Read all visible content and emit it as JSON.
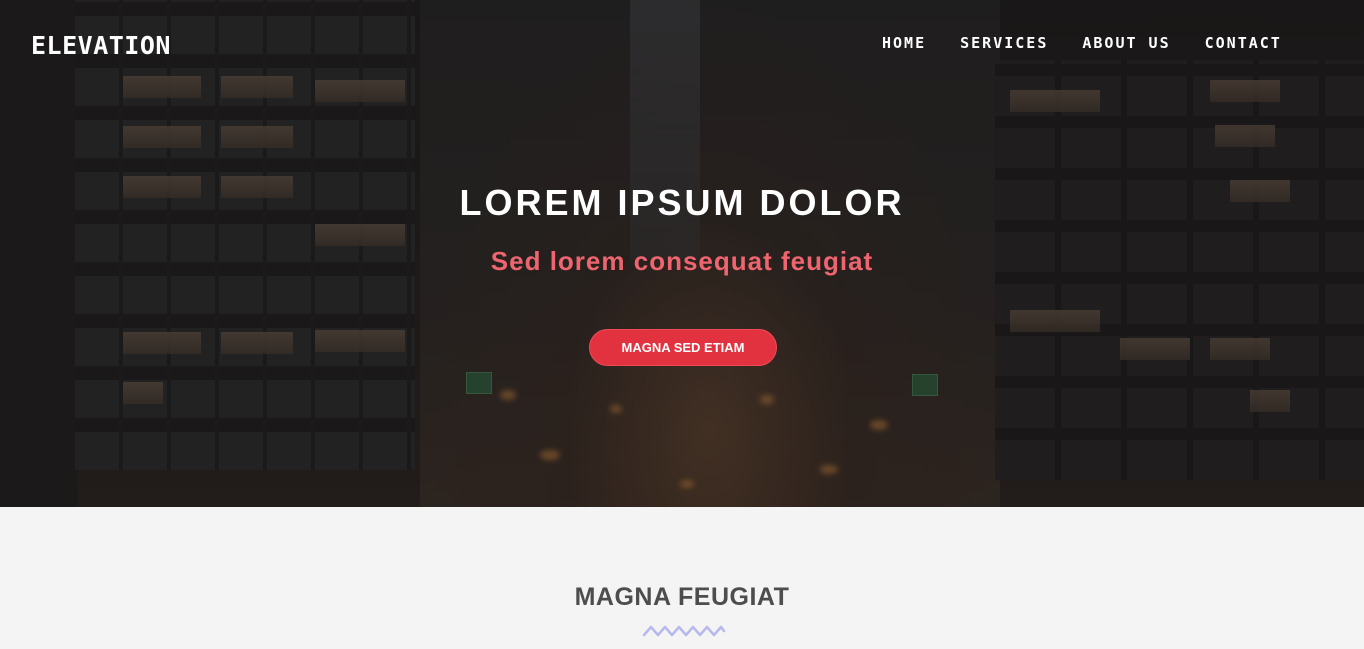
{
  "header": {
    "logo": "ELEVATION",
    "nav": [
      "HOME",
      "SERVICES",
      "ABOUT US",
      "CONTACT"
    ]
  },
  "hero": {
    "title": "LOREM IPSUM DOLOR",
    "subtitle": "Sed lorem consequat feugiat",
    "cta_label": "MAGNA SED ETIAM"
  },
  "section": {
    "title": "MAGNA FEUGIAT",
    "divider_icon": "zigzag-divider-icon"
  },
  "colors": {
    "accent": "#e2323f",
    "subtitle": "#ee6570",
    "divider": "#b7b9ec",
    "section_bg": "#f4f4f4",
    "heading_dark": "#4d4d4d"
  }
}
